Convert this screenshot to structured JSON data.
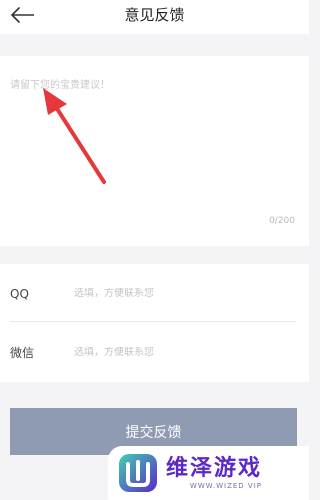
{
  "header": {
    "title": "意见反馈",
    "back_icon": "arrow-left-icon"
  },
  "feedback": {
    "placeholder": "请留下您的宝贵建议！",
    "value": "",
    "counter": "0/200"
  },
  "contact": {
    "qq": {
      "label": "QQ",
      "placeholder": "选填，方便联系您",
      "value": ""
    },
    "wechat": {
      "label": "微信",
      "placeholder": "选填，方便联系您",
      "value": ""
    }
  },
  "submit": {
    "label": "提交反馈"
  },
  "watermark": {
    "title": "维泽游戏",
    "subtitle": "WWW.WIZED VIP"
  },
  "colors": {
    "page_background": "#f4f4f6",
    "submit_button": "#8f9ab3",
    "annotation_arrow": "#e5383b",
    "watermark_purple": "#5b28c9"
  }
}
